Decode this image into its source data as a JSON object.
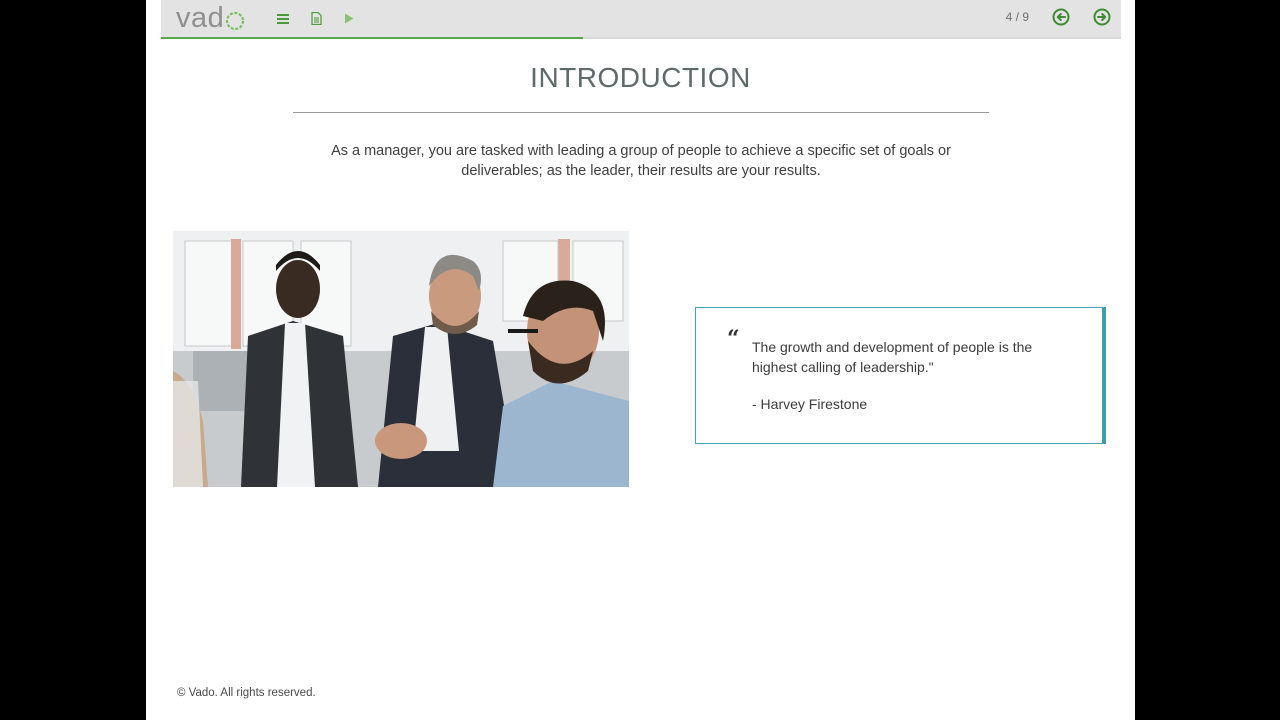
{
  "app": {
    "logo_text": "vad",
    "logo_ring_color": "#5aa84a"
  },
  "toolbar": {
    "menu_icon": "menu-icon",
    "notes_icon": "document-icon",
    "play_icon": "play-icon",
    "page_counter": "4 / 9",
    "prev_icon": "arrow-left-circle-icon",
    "next_icon": "arrow-right-circle-icon",
    "accent_color": "#4c9a3c",
    "progress_fraction": 0.44
  },
  "slide": {
    "title": "INTRODUCTION",
    "intro": "As a manager, you are tasked with leading a group of people to achieve a specific set of goals or deliverables; as the leader, their results are your results.",
    "quote_mark": "“",
    "quote": "The growth and development of people is the highest calling of leadership.\"",
    "author": "- Harvey Firestone",
    "quote_border_color": "#3f9fb0"
  },
  "footer": {
    "copyright": "© Vado. All rights reserved."
  }
}
